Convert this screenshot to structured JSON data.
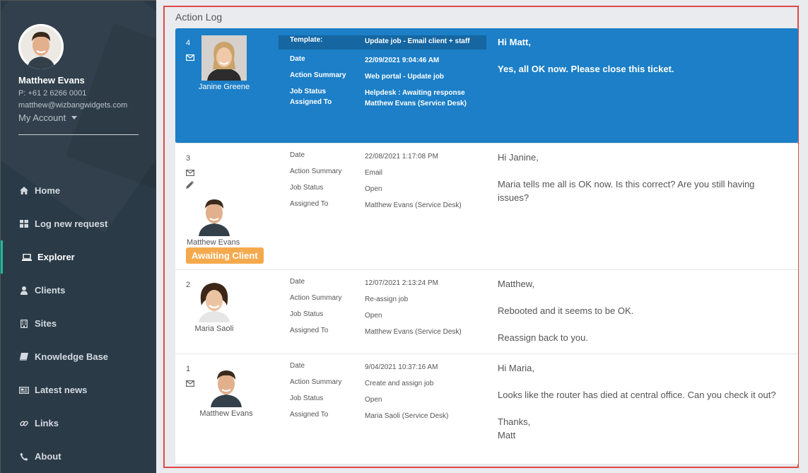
{
  "sidebar": {
    "user": {
      "name": "Matthew Evans",
      "phone": "P: +61 2 6266 0001",
      "email": "matthew@wizbangwidgets.com",
      "account_label": "My Account"
    },
    "nav": [
      {
        "label": "Home",
        "icon": "home-icon"
      },
      {
        "label": "Log new request",
        "icon": "grid-icon"
      },
      {
        "label": "Explorer",
        "icon": "laptop-icon",
        "active": true
      },
      {
        "label": "Clients",
        "icon": "user-icon"
      },
      {
        "label": "Sites",
        "icon": "building-icon"
      },
      {
        "label": "Knowledge Base",
        "icon": "book-icon"
      },
      {
        "label": "Latest news",
        "icon": "newspaper-icon"
      },
      {
        "label": "Links",
        "icon": "link-icon"
      },
      {
        "label": "About",
        "icon": "phone-icon"
      }
    ],
    "accent": "#1abc9c"
  },
  "main": {
    "title": "Action Log",
    "highlight_color": "#1c7fc7",
    "labels": {
      "template": "Template:",
      "date": "Date",
      "action_summary": "Action Summary",
      "job_status": "Job Status",
      "assigned_to": "Assigned To"
    },
    "entries": [
      {
        "number": "4",
        "person": "Janine Greene",
        "template": "Update job - Email client + staff",
        "date": "22/09/2021 9:04:46 AM",
        "action_summary": "Web portal - Update job",
        "job_status": "Helpdesk : Awaiting response",
        "assigned_to": "Matthew Evans (Service Desk)",
        "message": [
          "Hi Matt,",
          "Yes, all OK now.  Please close this ticket."
        ]
      },
      {
        "number": "3",
        "person": "Matthew Evans",
        "badge": "Awaiting Client",
        "date": "22/08/2021 1:17:08 PM",
        "action_summary": "Email",
        "job_status": "Open",
        "assigned_to": "Matthew Evans (Service Desk)",
        "message": [
          "Hi Janine,",
          "Maria tells me all is OK now.  Is this correct?  Are you still having issues?"
        ]
      },
      {
        "number": "2",
        "person": "Maria Saoli",
        "date": "12/07/2021 2:13:24 PM",
        "action_summary": "Re-assign job",
        "job_status": "Open",
        "assigned_to": "Matthew Evans (Service Desk)",
        "message": [
          "Matthew,",
          "Rebooted and it seems to be OK.",
          "Reassign back to you."
        ]
      },
      {
        "number": "1",
        "person": "Matthew Evans",
        "date": "9/04/2021 10:37:16 AM",
        "action_summary": "Create and assign job",
        "job_status": "Open",
        "assigned_to": "Maria Saoli (Service Desk)",
        "message": [
          "Hi Maria,",
          "Looks like the router has died at central office.  Can you check it out?",
          "Thanks,",
          "Matt"
        ]
      }
    ]
  }
}
